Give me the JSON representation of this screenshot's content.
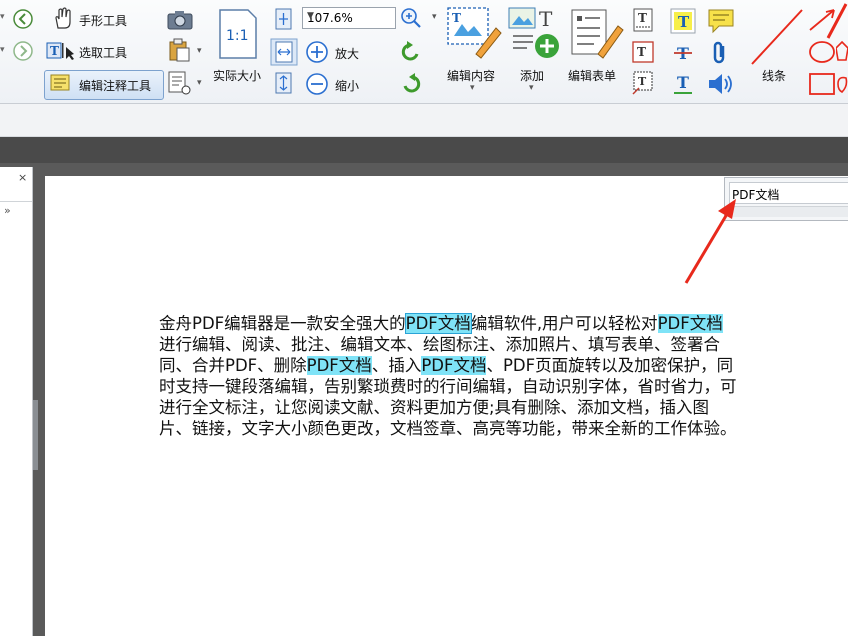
{
  "toolbar": {
    "hand_tool": "手形工具",
    "select_tool": "选取工具",
    "edit_annotation_tool": "编辑注释工具",
    "actual_size": "实际大小",
    "actual_size_icon_text": "1:1",
    "zoom_value": "107.6%",
    "zoom_in": "放大",
    "zoom_out": "缩小",
    "edit_content": "编辑内容",
    "add": "添加",
    "edit_form": "编辑表单",
    "lines": "线条"
  },
  "note": {
    "text": "PDF文档"
  },
  "document": {
    "line1_a": "金舟PDF编辑器是一款安全强大的",
    "line1_hl1": "PDF文档",
    "line1_b": "编辑软件,用户可以轻松对",
    "line1_hl2": "PDF文档",
    "line2": "进行编辑、阅读、批注、编辑文本、绘图标注、添加照片、填写表单、签署合",
    "line3_a": "同、合并PDF、删除",
    "line3_hl1": "PDF文档",
    "line3_b": "、插入",
    "line3_hl2": "PDF文档",
    "line3_c": "、PDF页面旋转以及加密保护，同",
    "line4": "时支持一键段落编辑，告别繁琐费时的行间编辑，自动识别字体，省时省力，可",
    "line5": "进行全文标注，让您阅读文献、资料更加方便;具有删除、添加文档，插入图",
    "line6": "片、链接，文字大小颜色更改，文档签章、高亮等功能，带来全新的工作体验。"
  },
  "colors": {
    "highlight": "#7fe3f7",
    "arrow": "#e8291c",
    "accent_blue": "#1a5fb4"
  }
}
